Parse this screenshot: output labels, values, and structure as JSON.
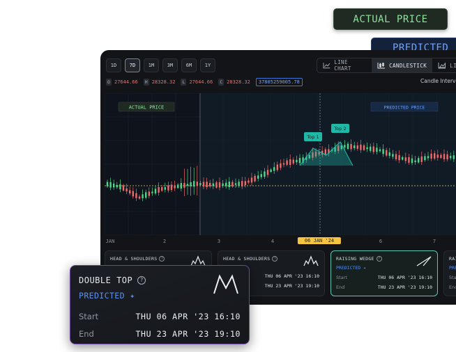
{
  "badges": {
    "actual": "ACTUAL PRICE",
    "predicted": "PREDICTED"
  },
  "toolbar": {
    "ranges": [
      "1D",
      "7D",
      "1M",
      "3M",
      "6M",
      "1Y"
    ],
    "active_range": "7D",
    "chart_types": [
      {
        "label": "LINE CHART",
        "icon": "line-chart-icon"
      },
      {
        "label": "CANDLESTICK",
        "icon": "candlestick-icon"
      },
      {
        "label": "LI",
        "icon": "area-chart-icon"
      }
    ],
    "active_type": "CANDLESTICK"
  },
  "ohlc": {
    "o_key": "O",
    "o": "27644.66",
    "h_key": "H",
    "h": "28328.32",
    "l_key": "L",
    "l": "27644.66",
    "c_key": "C",
    "c": "28328.32",
    "volume": "37805259005.78"
  },
  "interval_label": "Candle Interv",
  "chart": {
    "actual_label": "ACTUAL PRICE",
    "predicted_label": "PREDICTED PRICE",
    "top1": "Top 1",
    "top2": "Top 2",
    "colors": {
      "up": "#4fd68a",
      "down": "#f06a6a",
      "pattern": "#1fb8a6",
      "ref": "#e8d96a"
    }
  },
  "xaxis": [
    "JAN",
    "2",
    "3",
    "4",
    "06 JAN '24",
    "6",
    "7"
  ],
  "cards": [
    {
      "title": "HEAD & SHOULDERS",
      "predicted": "",
      "start_label": "",
      "start": "",
      "end_label": "",
      "end": "",
      "icon": "head-shoulders-icon"
    },
    {
      "title": "HEAD & SHOULDERS",
      "predicted": "",
      "start_label": "",
      "start": "THU 06 APR '23 16:10",
      "end_label": "",
      "end": "THU 23 APR '23 19:10",
      "icon": "head-shoulders-icon"
    },
    {
      "title": "RAISING WEDGE",
      "predicted": "PREDICTED",
      "start_label": "Start",
      "start": "THU 06 APR '23 16:10",
      "end_label": "End",
      "end": "THU 23 APR '23 19:10",
      "icon": "rising-wedge-icon"
    },
    {
      "title": "RAI",
      "predicted": "PRE",
      "start_label": "Sta",
      "start": "",
      "end_label": "End",
      "end": "",
      "icon": ""
    }
  ],
  "detail": {
    "title": "DOUBLE TOP",
    "predicted": "PREDICTED",
    "start_label": "Start",
    "start": "THU 06 APR '23 16:10",
    "end_label": "End",
    "end": "THU 23 APR '23 19:10",
    "icon": "double-top-icon"
  }
}
